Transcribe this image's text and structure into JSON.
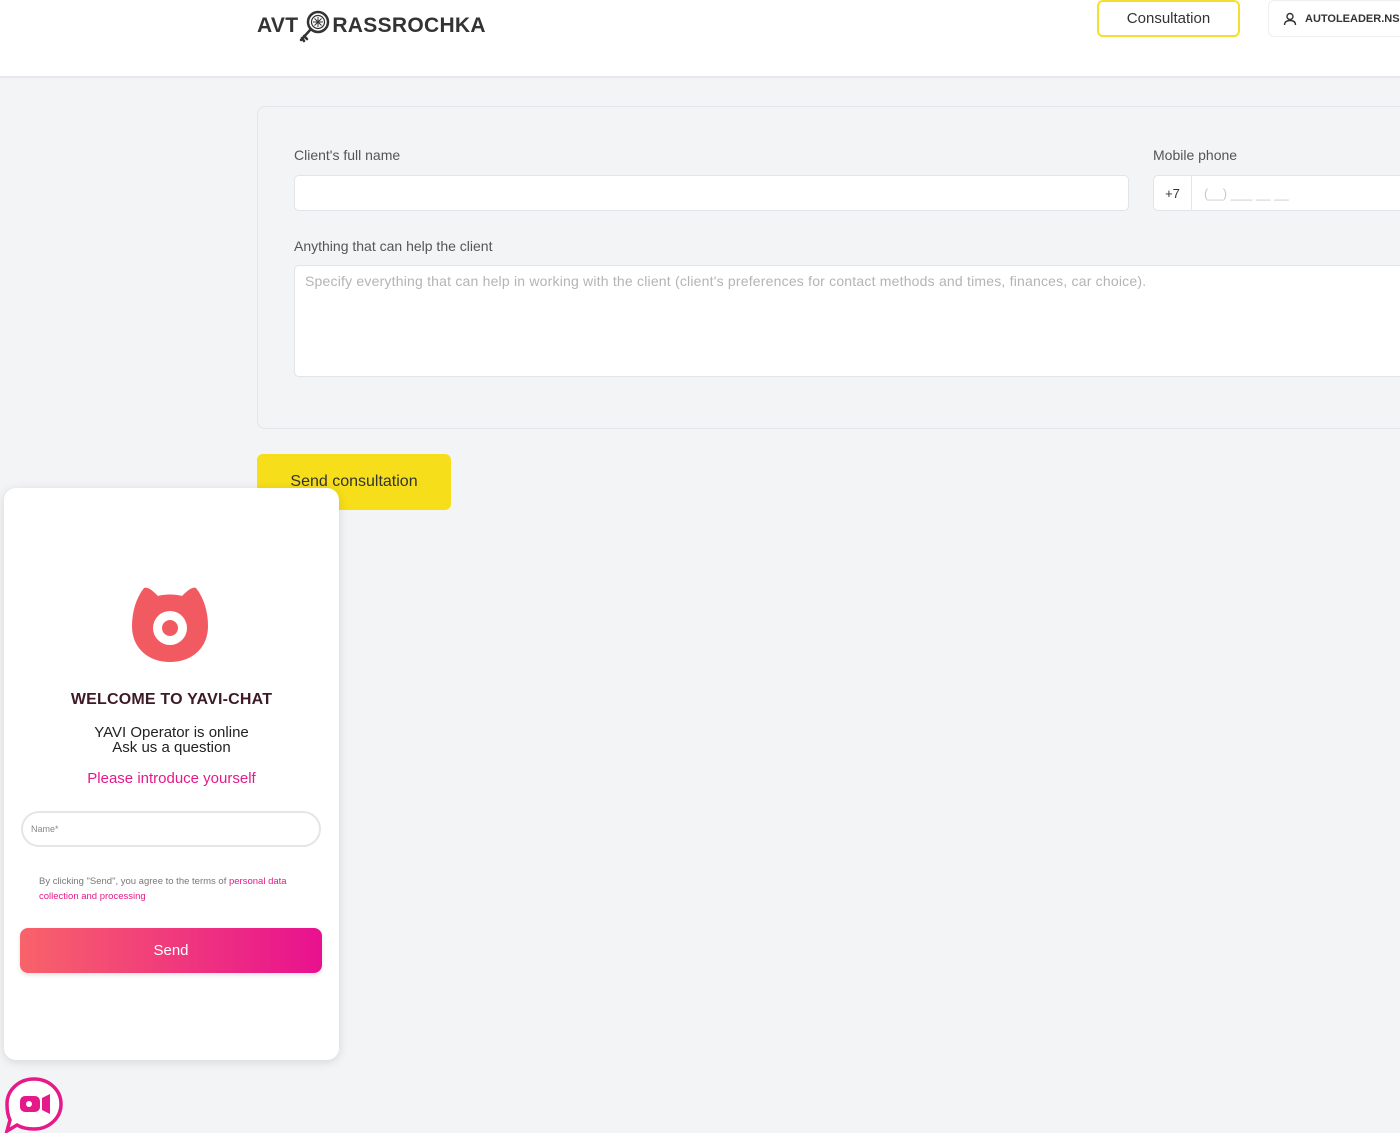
{
  "header": {
    "logo_text_left": "AVT",
    "logo_text_right": "RASSROCHKA",
    "consultation_button": "Consultation",
    "account_label": "AUTOLEADER.NSK"
  },
  "form": {
    "full_name_label": "Client's full name",
    "full_name_value": "",
    "phone_label": "Mobile phone",
    "phone_code": "+7",
    "phone_placeholder": "(__) ___ __ __",
    "notes_label": "Anything that can help the client",
    "notes_placeholder": "Specify everything that can help in working with the client (client's preferences for contact methods and times, finances, car choice).",
    "submit_button": "Send consultation"
  },
  "chat": {
    "title": "WELCOME TO YAVI-CHAT",
    "status_line": "YAVI Operator is online",
    "prompt_line": "Ask us a question",
    "intro": "Please introduce yourself",
    "name_placeholder": "Name*",
    "terms_prefix": "By clicking \"Send\", you agree to the terms of ",
    "terms_link": "personal data collection and processing",
    "send_button": "Send",
    "brand_color": "#e6198a",
    "logo_color": "#f25a62"
  },
  "colors": {
    "accent_yellow": "#f6de1a",
    "background": "#f3f4f6"
  }
}
